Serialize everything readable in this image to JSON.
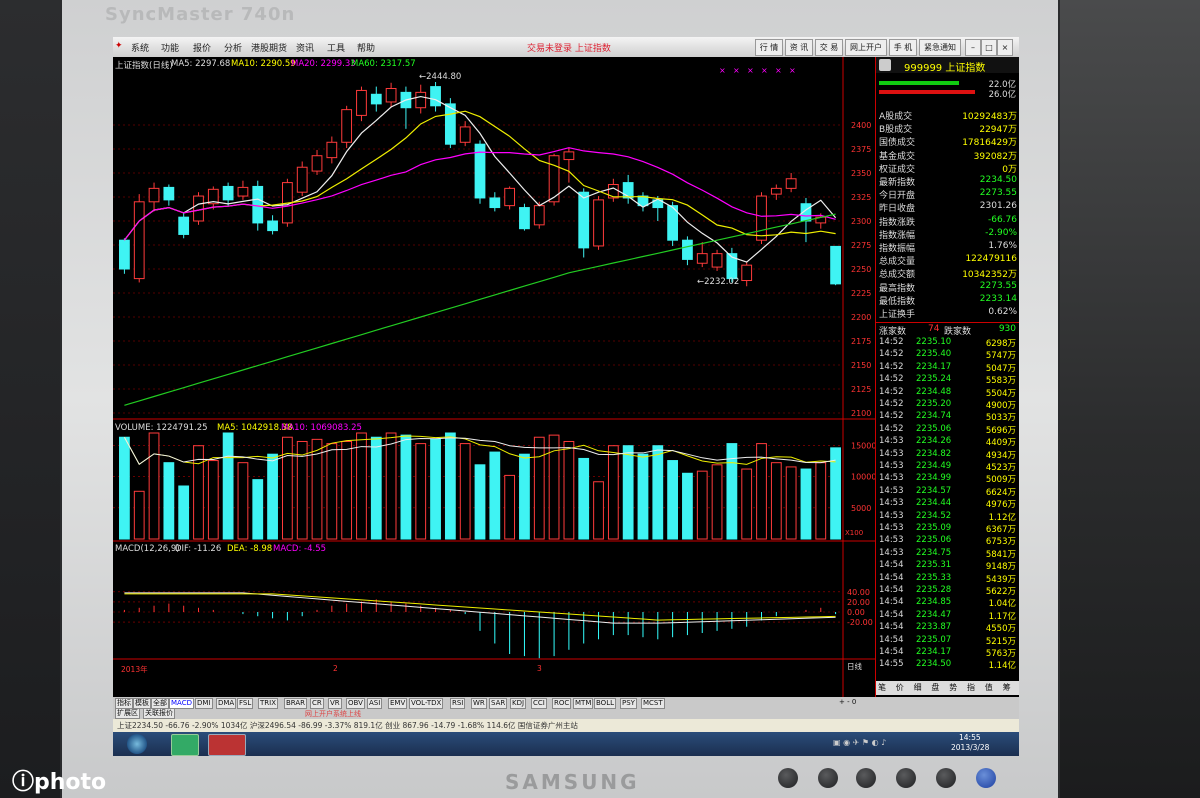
{
  "monitor": {
    "brand": "SyncMaster 740n",
    "maker": "SAMSUNG"
  },
  "watermark": "photo",
  "menu": {
    "items": [
      "系统",
      "功能",
      "报价",
      "分析",
      "港股期货",
      "资讯",
      "工具",
      "帮助"
    ],
    "center_title": "交易未登录  上证指数",
    "buttons": [
      "行 情",
      "资 讯",
      "交 易",
      "网上开户",
      "手 机",
      "紧急通知"
    ]
  },
  "price_header": {
    "name": "上证指数(日线)",
    "ma5": "MA5: 2297.68",
    "ma10": "MA10: 2290.59",
    "ma20": "MA20: 2299.33",
    "ma60": "MA60: 2317.57",
    "high_label": "2444.80",
    "low_label": "2232.02"
  },
  "price_axis": [
    "2400",
    "2375",
    "2350",
    "2325",
    "2300",
    "2275",
    "2250",
    "2225",
    "2200",
    "2175",
    "2150",
    "2125",
    "2100"
  ],
  "volume_header": {
    "vol": "VOLUME: 1224791.25",
    "ma5": "MA5: 1042918.38",
    "ma10": "MA10: 1069083.25"
  },
  "volume_axis": [
    "15000",
    "10000",
    "5000",
    "X100"
  ],
  "macd_header": {
    "name": "MACD(12,26,9)",
    "dif": "DIF: -11.26",
    "dea": "DEA: -8.98",
    "macd": "MACD: -4.55"
  },
  "macd_axis": [
    "40.00",
    "20.00",
    "0.00",
    "-20.00"
  ],
  "x_axis": {
    "year": "2013年",
    "m2": "2",
    "m3": "3",
    "period": "日线"
  },
  "chart_data": {
    "type": "candlestick",
    "candles": [
      {
        "o": 2250,
        "c": 2280,
        "h": 2282,
        "l": 2245,
        "up": false
      },
      {
        "o": 2240,
        "c": 2320,
        "h": 2328,
        "l": 2236,
        "up": true
      },
      {
        "o": 2320,
        "c": 2334,
        "h": 2340,
        "l": 2310,
        "up": true
      },
      {
        "o": 2335,
        "c": 2322,
        "h": 2338,
        "l": 2316,
        "up": false
      },
      {
        "o": 2304,
        "c": 2286,
        "h": 2308,
        "l": 2282,
        "up": false
      },
      {
        "o": 2300,
        "c": 2326,
        "h": 2330,
        "l": 2296,
        "up": true
      },
      {
        "o": 2318,
        "c": 2333,
        "h": 2336,
        "l": 2312,
        "up": true
      },
      {
        "o": 2336,
        "c": 2322,
        "h": 2340,
        "l": 2316,
        "up": false
      },
      {
        "o": 2326,
        "c": 2335,
        "h": 2342,
        "l": 2322,
        "up": true
      },
      {
        "o": 2336,
        "c": 2298,
        "h": 2342,
        "l": 2290,
        "up": false
      },
      {
        "o": 2300,
        "c": 2290,
        "h": 2306,
        "l": 2286,
        "up": false
      },
      {
        "o": 2298,
        "c": 2340,
        "h": 2344,
        "l": 2294,
        "up": true
      },
      {
        "o": 2330,
        "c": 2356,
        "h": 2362,
        "l": 2326,
        "up": true
      },
      {
        "o": 2352,
        "c": 2368,
        "h": 2374,
        "l": 2348,
        "up": true
      },
      {
        "o": 2366,
        "c": 2382,
        "h": 2388,
        "l": 2360,
        "up": true
      },
      {
        "o": 2382,
        "c": 2416,
        "h": 2420,
        "l": 2376,
        "up": true
      },
      {
        "o": 2410,
        "c": 2436,
        "h": 2440,
        "l": 2404,
        "up": true
      },
      {
        "o": 2432,
        "c": 2422,
        "h": 2440,
        "l": 2414,
        "up": false
      },
      {
        "o": 2424,
        "c": 2438,
        "h": 2444,
        "l": 2418,
        "up": true
      },
      {
        "o": 2434,
        "c": 2418,
        "h": 2440,
        "l": 2396,
        "up": false
      },
      {
        "o": 2418,
        "c": 2434,
        "h": 2442,
        "l": 2412,
        "up": true
      },
      {
        "o": 2440,
        "c": 2420,
        "h": 2444.8,
        "l": 2414,
        "up": false
      },
      {
        "o": 2422,
        "c": 2380,
        "h": 2428,
        "l": 2376,
        "up": false
      },
      {
        "o": 2382,
        "c": 2398,
        "h": 2404,
        "l": 2378,
        "up": true
      },
      {
        "o": 2380,
        "c": 2324,
        "h": 2384,
        "l": 2318,
        "up": false
      },
      {
        "o": 2324,
        "c": 2314,
        "h": 2330,
        "l": 2310,
        "up": false
      },
      {
        "o": 2316,
        "c": 2334,
        "h": 2336,
        "l": 2312,
        "up": true
      },
      {
        "o": 2314,
        "c": 2292,
        "h": 2318,
        "l": 2290,
        "up": false
      },
      {
        "o": 2296,
        "c": 2316,
        "h": 2320,
        "l": 2292,
        "up": true
      },
      {
        "o": 2320,
        "c": 2368,
        "h": 2370,
        "l": 2316,
        "up": true
      },
      {
        "o": 2364,
        "c": 2372,
        "h": 2376,
        "l": 2340,
        "up": true
      },
      {
        "o": 2330,
        "c": 2272,
        "h": 2334,
        "l": 2262,
        "up": false
      },
      {
        "o": 2274,
        "c": 2322,
        "h": 2326,
        "l": 2270,
        "up": true
      },
      {
        "o": 2324,
        "c": 2338,
        "h": 2344,
        "l": 2320,
        "up": true
      },
      {
        "o": 2340,
        "c": 2324,
        "h": 2348,
        "l": 2318,
        "up": false
      },
      {
        "o": 2326,
        "c": 2316,
        "h": 2330,
        "l": 2310,
        "up": false
      },
      {
        "o": 2322,
        "c": 2314,
        "h": 2326,
        "l": 2300,
        "up": false
      },
      {
        "o": 2316,
        "c": 2280,
        "h": 2320,
        "l": 2274,
        "up": false
      },
      {
        "o": 2280,
        "c": 2260,
        "h": 2284,
        "l": 2254,
        "up": false
      },
      {
        "o": 2256,
        "c": 2266,
        "h": 2278,
        "l": 2252,
        "up": true
      },
      {
        "o": 2252,
        "c": 2266,
        "h": 2270,
        "l": 2248,
        "up": true
      },
      {
        "o": 2266,
        "c": 2240,
        "h": 2272,
        "l": 2236,
        "up": false
      },
      {
        "o": 2238,
        "c": 2254,
        "h": 2258,
        "l": 2232.02,
        "up": true
      },
      {
        "o": 2280,
        "c": 2326,
        "h": 2330,
        "l": 2276,
        "up": true
      },
      {
        "o": 2328,
        "c": 2334,
        "h": 2338,
        "l": 2322,
        "up": true
      },
      {
        "o": 2334,
        "c": 2344,
        "h": 2350,
        "l": 2330,
        "up": true
      },
      {
        "o": 2318,
        "c": 2300,
        "h": 2324,
        "l": 2278,
        "up": false
      },
      {
        "o": 2298,
        "c": 2304,
        "h": 2308,
        "l": 2292,
        "up": true
      },
      {
        "o": 2273.55,
        "c": 2234.5,
        "h": 2273.55,
        "l": 2233.14,
        "up": false
      }
    ],
    "volumes": [
      96,
      45,
      100,
      72,
      50,
      88,
      74,
      100,
      72,
      56,
      80,
      96,
      92,
      94,
      90,
      92,
      100,
      96,
      100,
      98,
      90,
      94,
      100,
      90,
      70,
      82,
      60,
      80,
      96,
      98,
      92,
      76,
      54,
      88,
      88,
      80,
      88,
      74,
      62,
      64,
      70,
      90,
      66,
      90,
      72,
      68,
      66,
      72,
      86
    ],
    "price_range": [
      2100,
      2450
    ],
    "volume_max": 17000,
    "macd": [
      2,
      4,
      6,
      8,
      6,
      4,
      2,
      0,
      -2,
      -4,
      -6,
      -8,
      -4,
      2,
      6,
      8,
      10,
      12,
      10,
      8,
      6,
      4,
      2,
      -2,
      -18,
      -30,
      -40,
      -42,
      -44,
      -42,
      -36,
      -30,
      -26,
      -22,
      -22,
      -24,
      -26,
      -24,
      -22,
      -20,
      -18,
      -16,
      -14,
      -8,
      -4,
      0,
      2,
      4,
      -2
    ],
    "grid": true
  },
  "quote": {
    "code": "999999 上证指数",
    "bar1": "22.0亿",
    "bar2": "26.0亿",
    "stats": [
      {
        "label": "A股成交",
        "value": "10292483万",
        "color": "#ff0"
      },
      {
        "label": "B股成交",
        "value": "22947万",
        "color": "#ff0"
      },
      {
        "label": "国债成交",
        "value": "17816429万",
        "color": "#ff0"
      },
      {
        "label": "基金成交",
        "value": "392082万",
        "color": "#ff0"
      },
      {
        "label": "权证成交",
        "value": "0万",
        "color": "#ff0"
      },
      {
        "label": "最新指数",
        "value": "2234.50",
        "color": "#2f2"
      },
      {
        "label": "今日开盘",
        "value": "2273.55",
        "color": "#2f2"
      },
      {
        "label": "昨日收盘",
        "value": "2301.26",
        "color": "#ddd"
      },
      {
        "label": "指数涨跌",
        "value": "-66.76",
        "color": "#2f2"
      },
      {
        "label": "指数涨幅",
        "value": "-2.90%",
        "color": "#2f2"
      },
      {
        "label": "指数振幅",
        "value": "1.76%",
        "color": "#ddd"
      },
      {
        "label": "总成交量",
        "value": "122479116",
        "color": "#ff0"
      },
      {
        "label": "总成交额",
        "value": "10342352万",
        "color": "#ff0"
      },
      {
        "label": "最高指数",
        "value": "2273.55",
        "color": "#2f2"
      },
      {
        "label": "最低指数",
        "value": "2233.14",
        "color": "#2f2"
      },
      {
        "label": "上证换手",
        "value": "0.62%",
        "color": "#ddd"
      }
    ],
    "rise_label": "涨家数",
    "rise_count": "74",
    "fall_label": "跌家数",
    "fall_count": "930",
    "ticks": [
      {
        "t": "14:52",
        "p": "2235.10",
        "v": "6298万"
      },
      {
        "t": "14:52",
        "p": "2235.40",
        "v": "5747万"
      },
      {
        "t": "14:52",
        "p": "2234.17",
        "v": "5047万"
      },
      {
        "t": "14:52",
        "p": "2235.24",
        "v": "5583万"
      },
      {
        "t": "14:52",
        "p": "2234.48",
        "v": "5504万"
      },
      {
        "t": "14:52",
        "p": "2235.20",
        "v": "4900万"
      },
      {
        "t": "14:52",
        "p": "2234.74",
        "v": "5033万"
      },
      {
        "t": "14:52",
        "p": "2235.06",
        "v": "5696万"
      },
      {
        "t": "14:53",
        "p": "2234.26",
        "v": "4409万"
      },
      {
        "t": "14:53",
        "p": "2234.82",
        "v": "4934万"
      },
      {
        "t": "14:53",
        "p": "2234.49",
        "v": "4523万"
      },
      {
        "t": "14:53",
        "p": "2234.99",
        "v": "5009万"
      },
      {
        "t": "14:53",
        "p": "2234.57",
        "v": "6624万"
      },
      {
        "t": "14:53",
        "p": "2234.44",
        "v": "4976万"
      },
      {
        "t": "14:53",
        "p": "2234.52",
        "v": "1.12亿"
      },
      {
        "t": "14:53",
        "p": "2235.09",
        "v": "6367万"
      },
      {
        "t": "14:53",
        "p": "2235.06",
        "v": "6753万"
      },
      {
        "t": "14:53",
        "p": "2234.75",
        "v": "5841万"
      },
      {
        "t": "14:54",
        "p": "2235.31",
        "v": "9148万"
      },
      {
        "t": "14:54",
        "p": "2235.33",
        "v": "5439万"
      },
      {
        "t": "14:54",
        "p": "2235.28",
        "v": "5622万"
      },
      {
        "t": "14:54",
        "p": "2234.85",
        "v": "1.04亿"
      },
      {
        "t": "14:54",
        "p": "2234.47",
        "v": "1.17亿"
      },
      {
        "t": "14:54",
        "p": "2233.87",
        "v": "4550万"
      },
      {
        "t": "14:54",
        "p": "2235.07",
        "v": "5215万"
      },
      {
        "t": "14:54",
        "p": "2234.17",
        "v": "5763万"
      },
      {
        "t": "14:55",
        "p": "2234.50",
        "v": "1.14亿"
      }
    ],
    "bottom_tabs": [
      "笔",
      "价",
      "细",
      "盘",
      "势",
      "指",
      "值",
      "筹"
    ]
  },
  "tabs": {
    "row1": [
      "指标",
      "模板",
      "全部",
      "MACD",
      "DMI",
      "DMA",
      "FSL",
      "TRIX",
      "BRAR",
      "CR",
      "VR",
      "OBV",
      "ASI",
      "EMV",
      "VOL-TDX",
      "RSI",
      "WR",
      "SAR",
      "KDJ",
      "CCI",
      "ROC",
      "MTM",
      "BOLL",
      "PSY",
      "MCST"
    ],
    "row2": [
      "扩展区",
      "关联报价"
    ]
  },
  "ticker": "上证2234.50  -66.76  -2.90%  1034亿    沪深2496.54  -86.99  -3.37%  819.1亿    创业 867.96  -14.79  -1.68%  114.6亿        国信证券广州主站",
  "scroll_notice": "网上开户系统上线",
  "clock": {
    "time": "14:55",
    "date": "2013/3/28"
  }
}
